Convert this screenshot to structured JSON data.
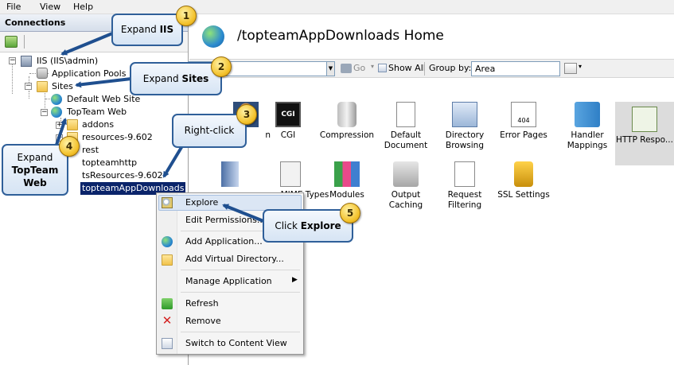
{
  "menu": {
    "file": "File",
    "view": "View",
    "help": "Help"
  },
  "connections": {
    "header": "Connections",
    "tree": {
      "server": "IIS (IIS\\admin)",
      "app_pools": "Application Pools",
      "sites": "Sites",
      "default_site": "Default Web Site",
      "topteam_web": "TopTeam Web",
      "addons": "addons",
      "resources": "resources-9.602",
      "rest": "rest",
      "topteamhttp": "topteamhttp",
      "tsresources": "tsResources-9.602",
      "downloads": "topteamAppDownloads"
    }
  },
  "main": {
    "title": "/topteamAppDownloads Home",
    "filter": {
      "go": "Go",
      "show_all": "Show All",
      "group_by": "Group by:",
      "group_value": "Area"
    },
    "features": [
      {
        "label": "n",
        "icon": "authentication-icon"
      },
      {
        "label": "CGI",
        "icon": "cgi-icon"
      },
      {
        "label": "Compression",
        "icon": "compression-icon"
      },
      {
        "label": "Default Document",
        "icon": "default-document-icon"
      },
      {
        "label": "Directory Browsing",
        "icon": "directory-browsing-icon"
      },
      {
        "label": "Error Pages",
        "icon": "error-pages-icon"
      },
      {
        "label": "Handler Mappings",
        "icon": "handler-mappings-icon"
      },
      {
        "label": "HTTP Respo...",
        "icon": "http-response-icon"
      },
      {
        "label": "Modules",
        "icon": "modules-icon"
      },
      {
        "label": "Output Caching",
        "icon": "output-caching-icon"
      },
      {
        "label": "Request Filtering",
        "icon": "request-filtering-icon"
      },
      {
        "label": "SSL Settings",
        "icon": "ssl-settings-icon"
      }
    ],
    "partial_label": "MIME Types"
  },
  "context_menu": {
    "explore": "Explore",
    "edit_permissions": "Edit Permissions...",
    "add_application": "Add Application...",
    "add_virtual_directory": "Add Virtual Directory...",
    "manage_application": "Manage Application",
    "refresh": "Refresh",
    "remove": "Remove",
    "switch_content_view": "Switch to Content View"
  },
  "callouts": {
    "c1": {
      "num": "1",
      "pre": "Expand ",
      "bold": "IIS"
    },
    "c2": {
      "num": "2",
      "pre": "Expand ",
      "bold": "Sites"
    },
    "c3": {
      "num": "3",
      "text": "Right-click"
    },
    "c4": {
      "num": "4",
      "line1": "Expand",
      "bold1": "TopTeam",
      "bold2": "Web"
    },
    "c5": {
      "num": "5",
      "pre": "Click ",
      "bold": "Explore"
    }
  },
  "colors": {
    "callout_border": "#2f5f99",
    "arrow": "#1f4f8f",
    "badge": "#f3c12a",
    "selection": "#0a246a"
  }
}
